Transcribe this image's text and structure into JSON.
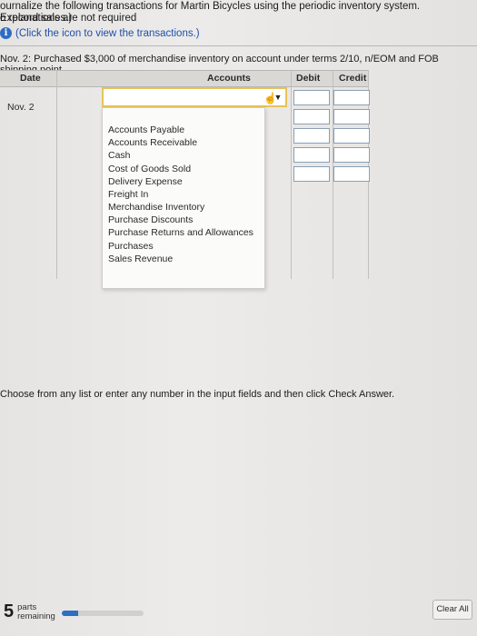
{
  "instructions": {
    "line1": "ournalize the following transactions for Martin Bicycles using the periodic inventory system. Explanations are not required",
    "line2": "o record sales.)",
    "info_link": "(Click the icon to view the transactions.)"
  },
  "question": "Nov. 2: Purchased $3,000 of merchandise inventory on account under terms 2/10, n/EOM and FOB shipping point.",
  "table": {
    "headers": {
      "date": "Date",
      "accounts": "Accounts",
      "debit": "Debit",
      "credit": "Credit"
    },
    "date_value": "Nov. 2"
  },
  "account_options": [
    "Accounts Payable",
    "Accounts Receivable",
    "Cash",
    "Cost of Goods Sold",
    "Delivery Expense",
    "Freight In",
    "Merchandise Inventory",
    "Purchase Discounts",
    "Purchase Returns and Allowances",
    "Purchases",
    "Sales Revenue"
  ],
  "note": "Choose from any list or enter any number in the input fields and then click Check Answer.",
  "footer": {
    "parts_count": "5",
    "parts_label_1": "parts",
    "parts_label_2": "remaining",
    "progress_fraction": 0.2,
    "clear_all": "Clear All"
  },
  "colors": {
    "accent": "#2d6ec3",
    "focus_border": "#e6c25a"
  },
  "icons": {
    "info": "info-icon",
    "dropdown": "chevron-down-icon"
  }
}
